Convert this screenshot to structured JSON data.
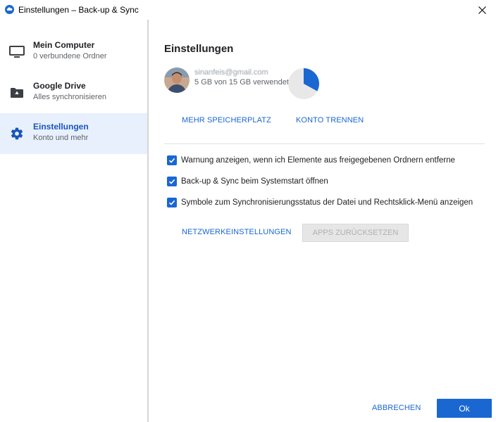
{
  "window": {
    "title": "Einstellungen – Back-up & Sync",
    "app_icon": "backup-sync-cloud-icon",
    "close_icon": "close-icon"
  },
  "sidebar": {
    "items": [
      {
        "title": "Mein Computer",
        "subtitle": "0 verbundene Ordner",
        "icon": "monitor-icon",
        "active": false
      },
      {
        "title": "Google Drive",
        "subtitle": "Alles synchronisieren",
        "icon": "drive-folder-icon",
        "active": false
      },
      {
        "title": "Einstellungen",
        "subtitle": "Konto und mehr",
        "icon": "gear-icon",
        "active": true
      }
    ]
  },
  "main": {
    "title": "Einstellungen",
    "account": {
      "email": "sinanfeis@gmail.com",
      "usage": "5 GB von 15 GB verwendet",
      "used_fraction": 0.33
    },
    "account_actions": {
      "more_storage": "Mehr Speicherplatz",
      "disconnect": "Konto trennen"
    },
    "options": [
      {
        "label": "Warnung anzeigen, wenn ich Elemente aus freigegebenen Ordnern entferne",
        "checked": true
      },
      {
        "label": "Back-up & Sync beim Systemstart öffnen",
        "checked": true
      },
      {
        "label": "Symbole zum Synchronisierungsstatus der Datei und Rechtsklick-Menü anzeigen",
        "checked": true
      }
    ],
    "network_settings": "Netzwerkeinstellungen",
    "reset_apps": "Apps zurücksetzen"
  },
  "footer": {
    "cancel": "Abbrechen",
    "ok": "Ok"
  },
  "colors": {
    "accent": "#1a67d2",
    "active_bg": "#e8f0fe",
    "pie_used": "#1a67d2",
    "pie_free": "#e8e8e8"
  }
}
